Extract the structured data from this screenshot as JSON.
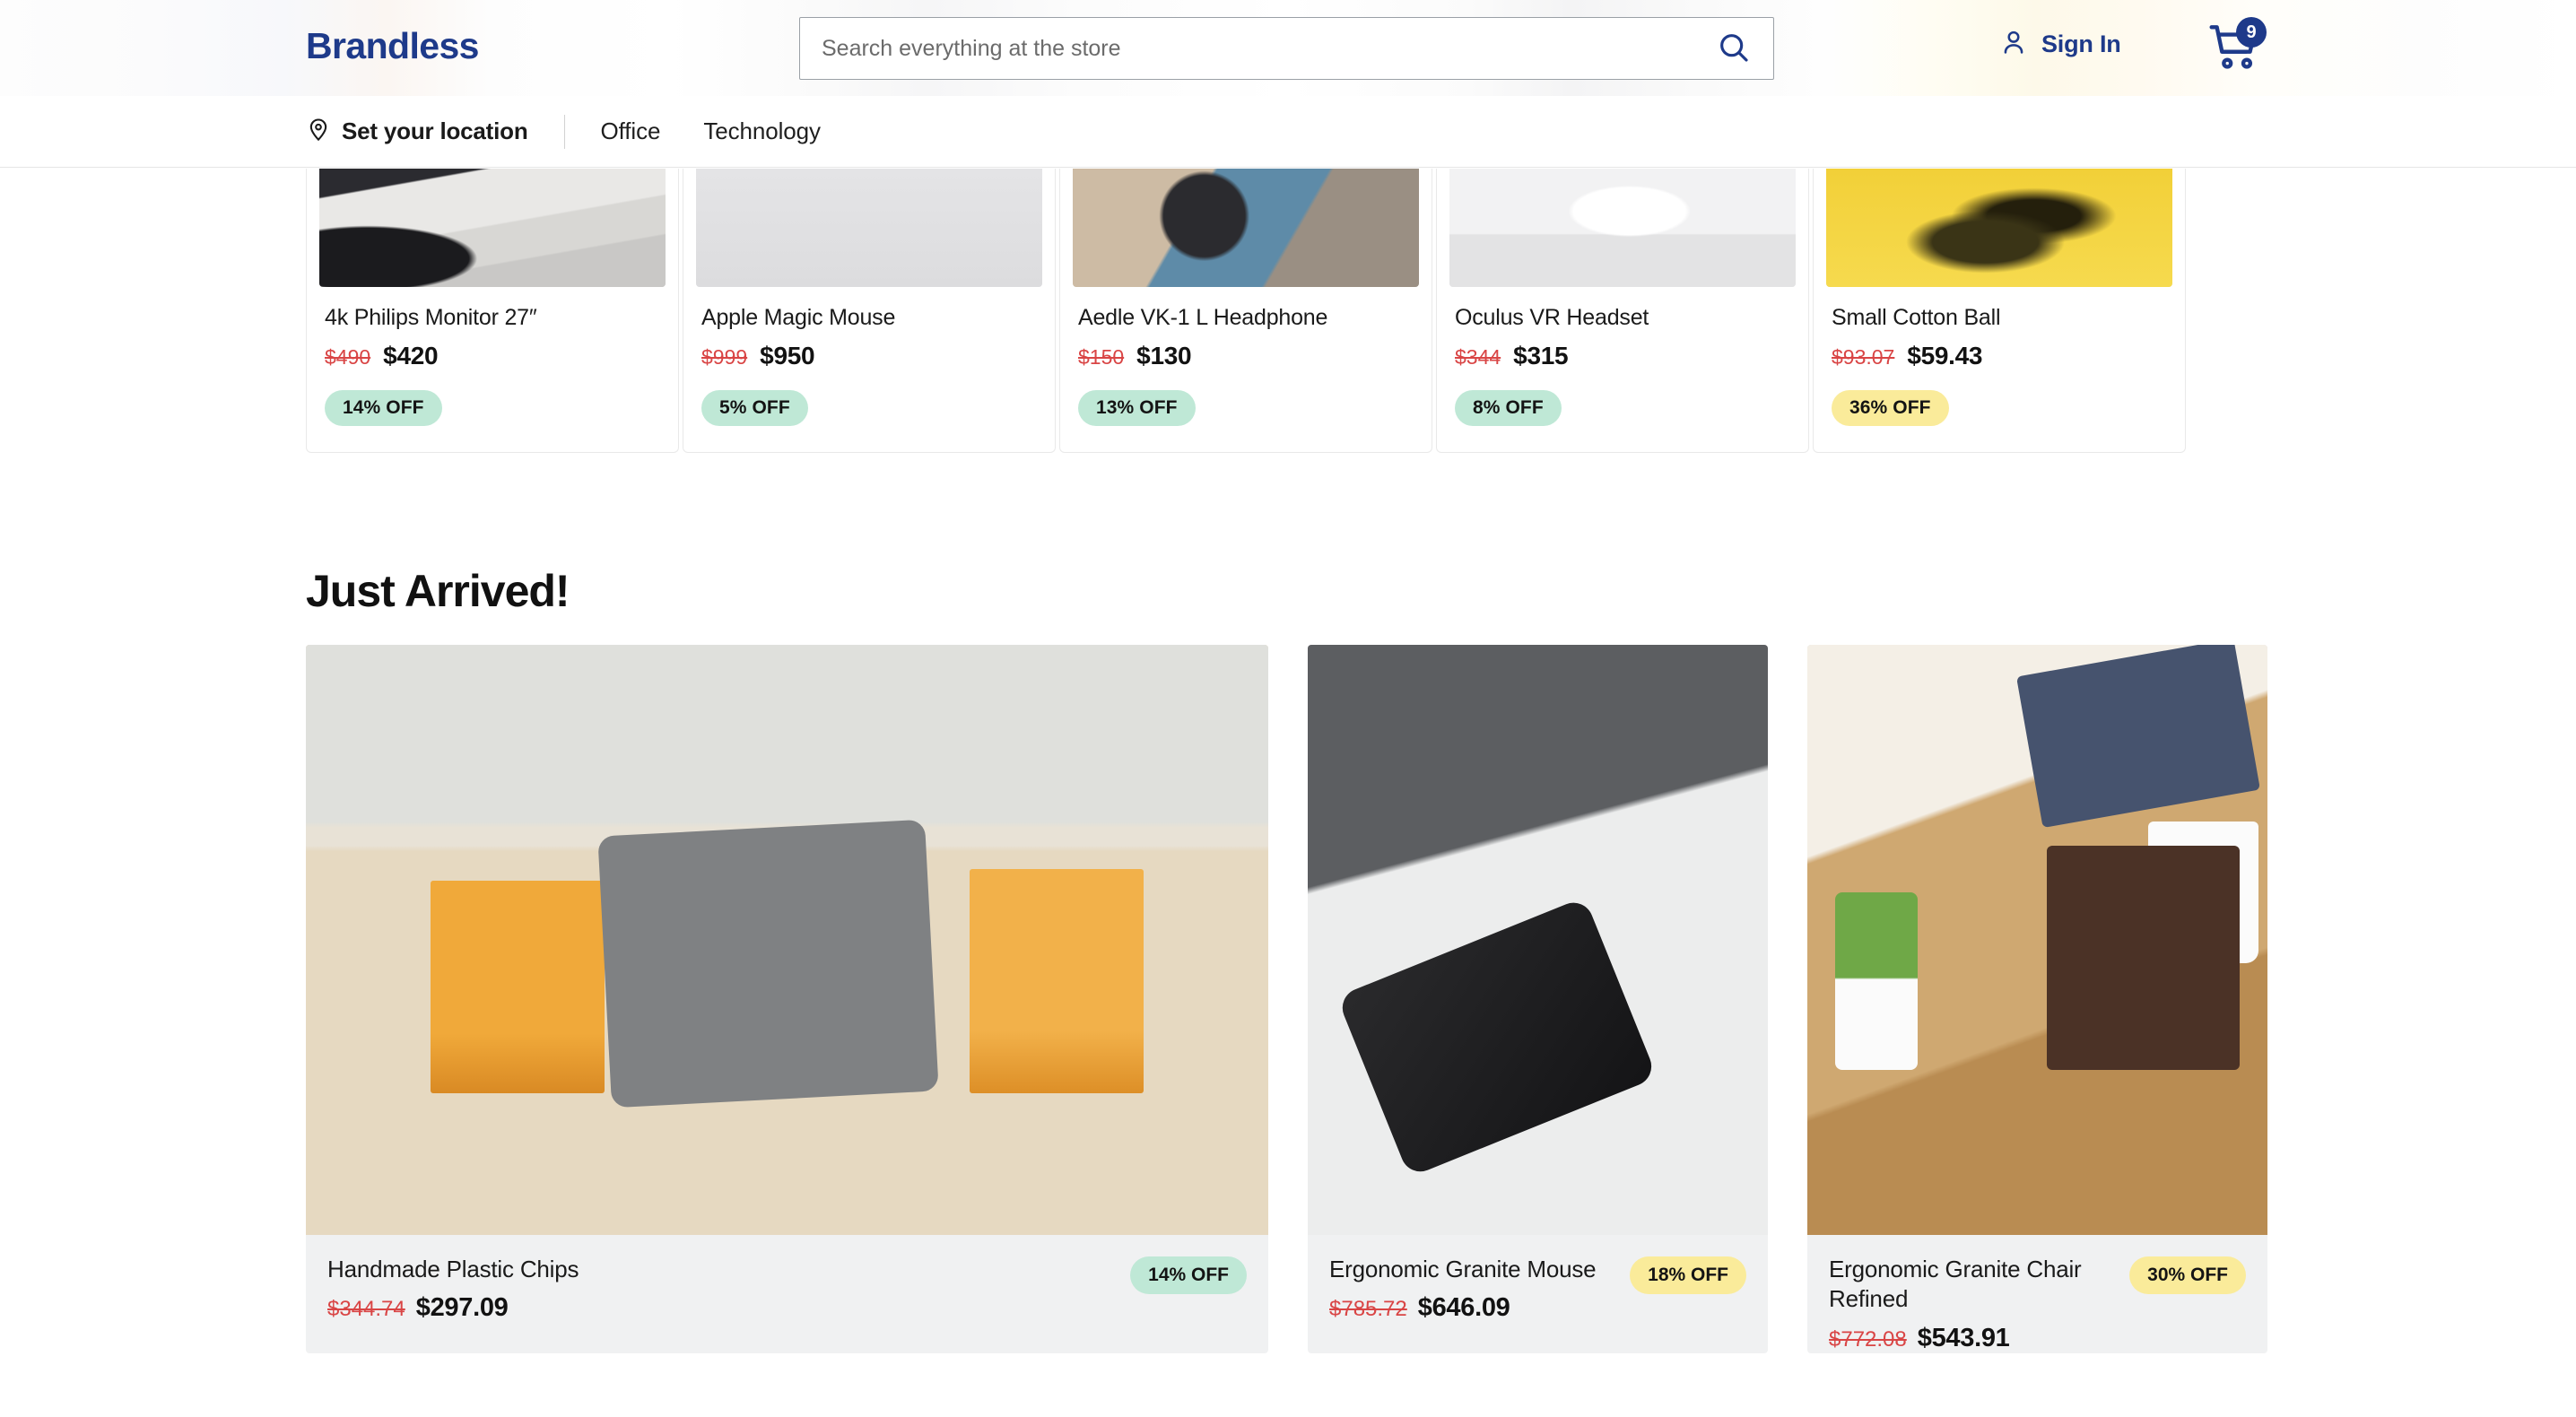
{
  "header": {
    "brand": "Brandless",
    "search": {
      "placeholder": "Search everything at the store",
      "value": "",
      "icon": "search-icon"
    },
    "sign_in_label": "Sign In",
    "user_icon": "user-icon",
    "cart_icon": "shopping-cart-icon",
    "cart_count": "9",
    "accent_color": "#1e3a8a"
  },
  "subnav": {
    "location_icon": "map-pin-icon",
    "location_label": "Set your location",
    "links": [
      {
        "label": "Office"
      },
      {
        "label": "Technology"
      }
    ]
  },
  "deals": {
    "items": [
      {
        "title": "4k Philips Monitor 27″",
        "price_old": "$490",
        "price_new": "$420",
        "discount": "14% OFF",
        "badge_color": "green",
        "image": "monitor-keyboard-photo"
      },
      {
        "title": "Apple Magic Mouse",
        "price_old": "$999",
        "price_new": "$950",
        "discount": "5% OFF",
        "badge_color": "green",
        "image": "magic-mouse-photo"
      },
      {
        "title": "Aedle VK-1 L Headphone",
        "price_old": "$150",
        "price_new": "$130",
        "discount": "13% OFF",
        "badge_color": "green",
        "image": "headphone-photo"
      },
      {
        "title": "Oculus VR Headset",
        "price_old": "$344",
        "price_new": "$315",
        "discount": "8% OFF",
        "badge_color": "green",
        "image": "vr-headset-photo"
      },
      {
        "title": "Small Cotton Ball",
        "price_old": "$93.07",
        "price_new": "$59.43",
        "discount": "36% OFF",
        "badge_color": "yellow",
        "image": "cotton-ball-photo"
      }
    ]
  },
  "just_arrived": {
    "title": "Just Arrived!",
    "items": [
      {
        "title": "Handmade Plastic Chips",
        "price_old": "$344.74",
        "price_new": "$297.09",
        "discount": "14% OFF",
        "badge_color": "green",
        "image": "office-lounge-table-photo"
      },
      {
        "title": "Ergonomic Granite Mouse",
        "price_old": "$785.72",
        "price_new": "$646.09",
        "discount": "18% OFF",
        "badge_color": "yellow",
        "image": "phone-on-desk-photo"
      },
      {
        "title": "Ergonomic Granite Chair Refined",
        "price_old": "$772.08",
        "price_new": "$543.91",
        "discount": "30% OFF",
        "badge_color": "yellow",
        "image": "desk-with-coffee-photo"
      }
    ]
  },
  "colors": {
    "brand_blue": "#1e3a8a",
    "badge_green": "#bfe8d6",
    "badge_yellow": "#faeb9a",
    "price_old_red": "#d94545",
    "card_bg": "#f0f1f2"
  }
}
